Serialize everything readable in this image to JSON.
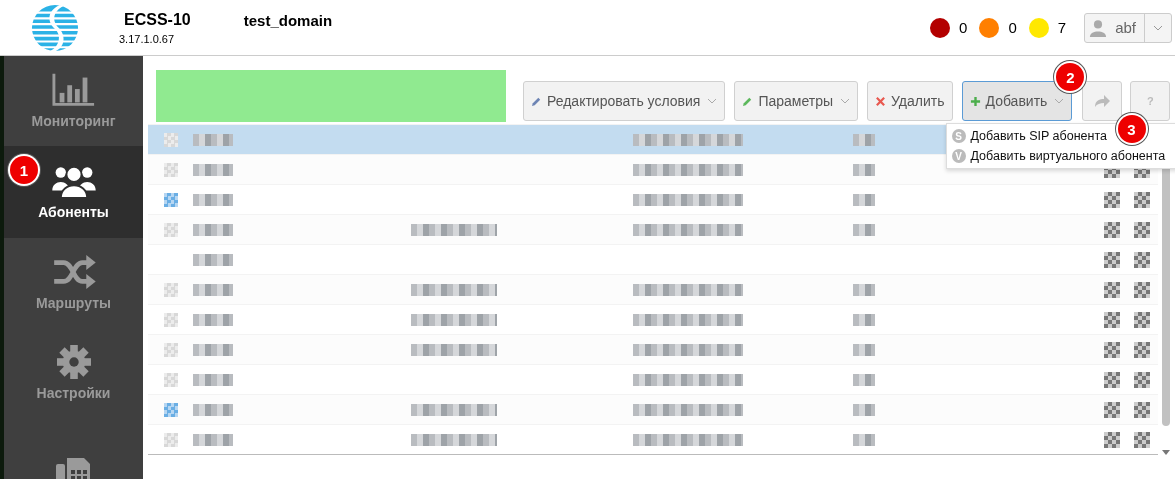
{
  "header": {
    "product": "ECSS-10",
    "version": "3.17.1.0.67",
    "domain": "test_domain",
    "alarms": [
      {
        "color": "#b30000",
        "count": "0"
      },
      {
        "color": "#ff7f00",
        "count": "0"
      },
      {
        "color": "#ffe800",
        "count": "7"
      }
    ],
    "user": "abf"
  },
  "sidebar": {
    "items": [
      {
        "label": "Мониторинг",
        "selected": false
      },
      {
        "label": "Абоненты",
        "selected": true
      },
      {
        "label": "Маршруты",
        "selected": false
      },
      {
        "label": "Настройки",
        "selected": false
      },
      {
        "selected": false
      }
    ]
  },
  "toolbar": {
    "buttons": [
      {
        "label": "Редактировать условия",
        "dropdown": true,
        "pressed": false
      },
      {
        "label": "Параметры",
        "dropdown": true,
        "pressed": false
      },
      {
        "label": "Удалить",
        "dropdown": false,
        "pressed": false
      },
      {
        "label": "Добавить",
        "dropdown": true,
        "pressed": true
      }
    ],
    "help": "?"
  },
  "menu": [
    {
      "badge": "S",
      "label": "Добавить SIP абонента"
    },
    {
      "badge": "V",
      "label": "Добавить виртуального абонента"
    }
  ],
  "table": {
    "rows": [
      {
        "selected": true,
        "kind": "grey",
        "column_2": false,
        "column_3": true,
        "actions": false
      },
      {
        "selected": false,
        "kind": "grey",
        "column_2": false,
        "column_3": true,
        "actions": true
      },
      {
        "selected": false,
        "kind": "blue",
        "column_2": false,
        "column_3": true,
        "actions": true
      },
      {
        "selected": false,
        "kind": "grey",
        "column_2": true,
        "column_3": true,
        "actions": true
      },
      {
        "selected": false,
        "kind": "none",
        "column_2": false,
        "column_3": false,
        "actions": true
      },
      {
        "selected": false,
        "kind": "grey",
        "column_2": true,
        "column_3": true,
        "actions": true
      },
      {
        "selected": false,
        "kind": "grey",
        "column_2": true,
        "column_3": true,
        "actions": true
      },
      {
        "selected": false,
        "kind": "grey",
        "column_2": true,
        "column_3": true,
        "actions": true
      },
      {
        "selected": false,
        "kind": "grey",
        "column_2": false,
        "column_3": true,
        "actions": true
      },
      {
        "selected": false,
        "kind": "blue",
        "column_2": true,
        "column_3": true,
        "actions": true
      },
      {
        "selected": false,
        "kind": "grey",
        "column_2": true,
        "column_3": true,
        "actions": true
      }
    ]
  },
  "annotations": [
    "1",
    "2",
    "3"
  ]
}
